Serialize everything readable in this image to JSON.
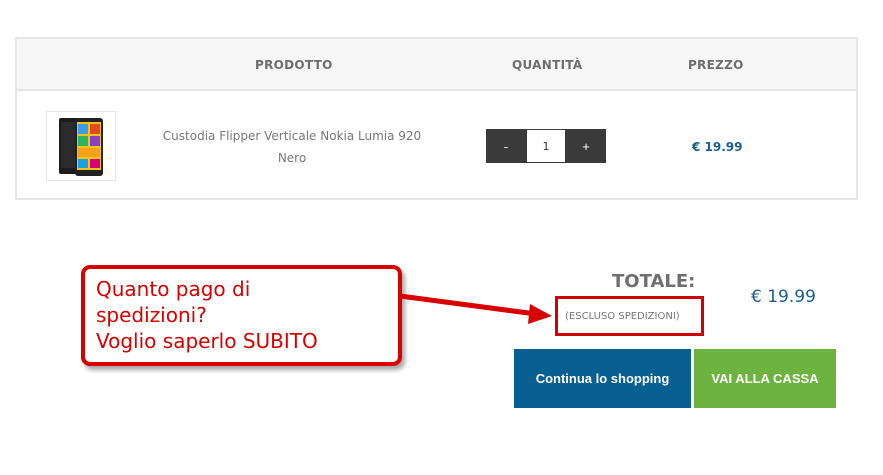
{
  "cart": {
    "headers": {
      "product": "PRODOTTO",
      "quantity": "QUANTITÀ",
      "price": "PREZZO"
    },
    "item": {
      "name_line1": "Custodia Flipper Verticale Nokia Lumia 920",
      "name_line2": "Nero",
      "quantity": "1",
      "decrement_label": "-",
      "increment_label": "+",
      "price": "€ 19.99"
    }
  },
  "summary": {
    "total_label": "TOTALE:",
    "total_value": "€ 19.99",
    "excluded_note": "(ESCLUSO SPEDIZIONI)"
  },
  "actions": {
    "continue_label": "Continua lo shopping",
    "checkout_label": "VAI ALLA CASSA"
  },
  "annotation": {
    "line1": "Quanto pago di",
    "line2": "spedizioni?",
    "line3": "Voglio saperlo SUBITO"
  },
  "colors": {
    "accent_blue": "#075f92",
    "checkout_green": "#6db33f",
    "annotation_red": "#d80000"
  }
}
